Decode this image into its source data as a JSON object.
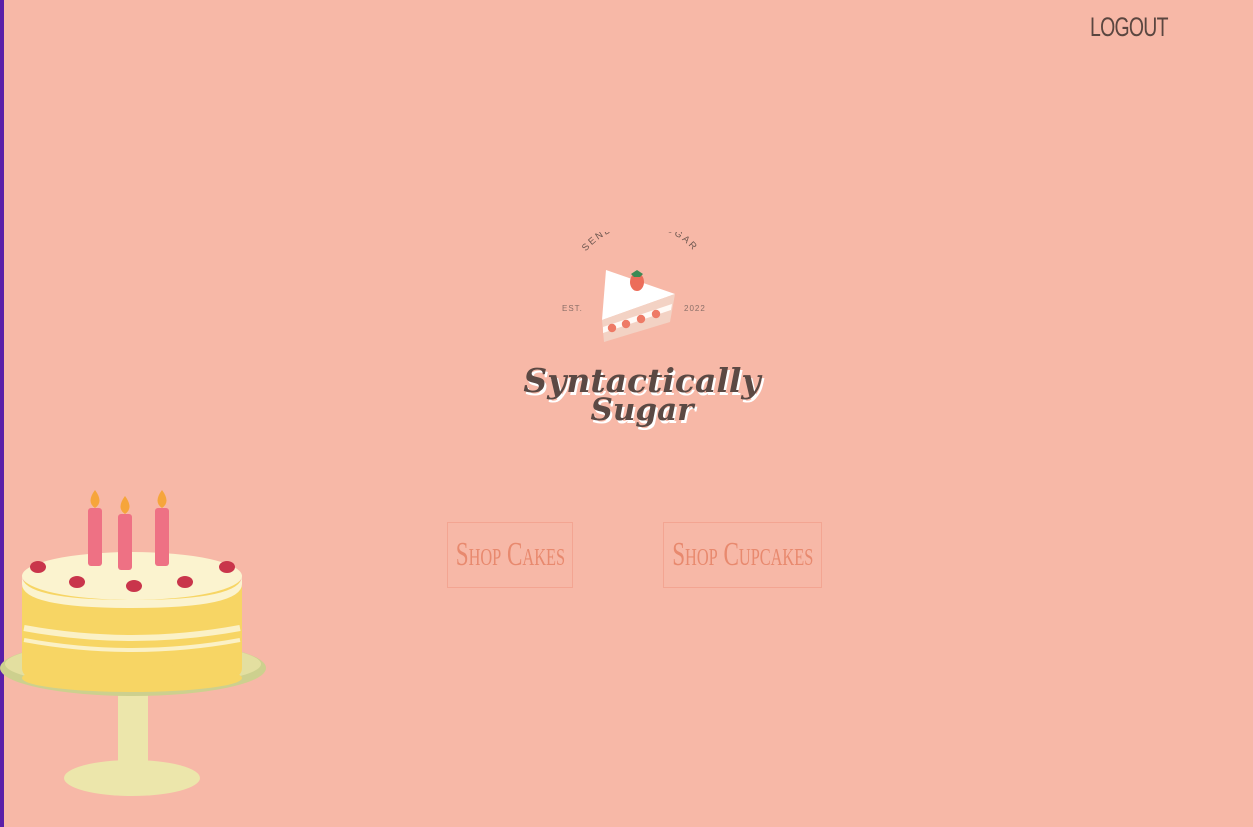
{
  "header": {
    "logout_label": "LOGOUT"
  },
  "logo": {
    "tagline": "SEND SOME SUGAR",
    "est_label": "EST.",
    "est_year": "2022",
    "brand_line1": "Syntactically",
    "brand_line2": "Sugar"
  },
  "actions": {
    "shop_cakes_label": "Shop Cakes",
    "shop_cupcakes_label": "Shop Cupcakes"
  },
  "colors": {
    "background": "#f7b8a7",
    "button_text": "#e8896e",
    "logout_text": "#5a4640",
    "edge_accent": "#5b1fa8"
  },
  "decor": {
    "illustration": "birthday-cake-icon"
  }
}
